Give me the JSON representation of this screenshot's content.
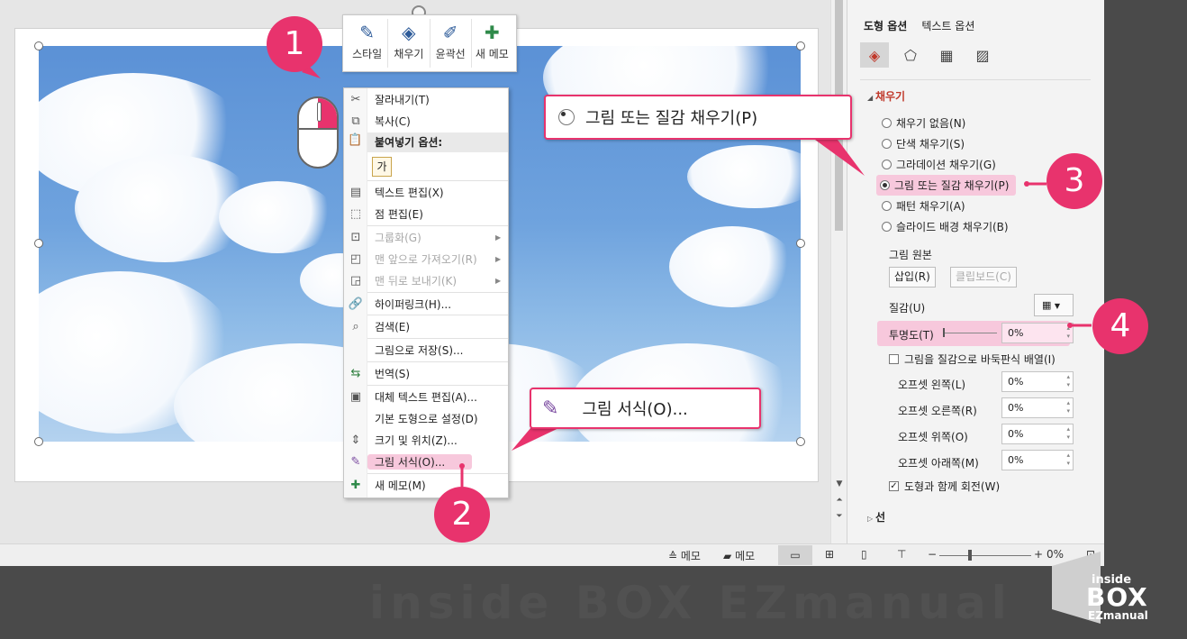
{
  "mini_toolbar": {
    "items": [
      {
        "label": "스타일",
        "icon": "style-brush-icon"
      },
      {
        "label": "채우기",
        "icon": "fill-bucket-icon"
      },
      {
        "label": "윤곽선",
        "icon": "outline-pen-icon"
      },
      {
        "label": "새 메모",
        "icon": "new-comment-icon"
      }
    ]
  },
  "context_menu": {
    "cut": "잘라내기(T)",
    "copy": "복사(C)",
    "paste_options": "붙여넣기 옵션:",
    "paste_glyph": "가",
    "edit_text": "텍스트 편집(X)",
    "edit_points": "점 편집(E)",
    "group": "그룹화(G)",
    "bring_front": "맨 앞으로 가져오기(R)",
    "send_back": "맨 뒤로 보내기(K)",
    "hyperlink": "하이퍼링크(H)...",
    "search": "검색(E)",
    "save_as_picture": "그림으로 저장(S)...",
    "translate": "번역(S)",
    "alt_text": "대체 텍스트 편집(A)...",
    "set_default": "기본 도형으로 설정(D)",
    "size_position": "크기 및 위치(Z)...",
    "format_picture": "그림 서식(O)...",
    "new_comment": "새 메모(M)"
  },
  "callouts": {
    "n1": "1",
    "n2": "2",
    "n3": "3",
    "n4": "4",
    "box_picture_fill": "그림 또는 질감 채우기(P)",
    "box_format_picture": "그림 서식(O)...",
    "accent": "#e8336d"
  },
  "format_pane": {
    "tab_shape": "도형 옵션",
    "tab_text": "텍스트 옵션",
    "fill_section": "채우기",
    "fill_options": [
      "채우기 없음(N)",
      "단색 채우기(S)",
      "그라데이션 채우기(G)",
      "그림 또는 질감 채우기(P)",
      "패턴 채우기(A)",
      "슬라이드 배경 채우기(B)"
    ],
    "selected_fill_index": 3,
    "picture_source": "그림 원본",
    "insert_btn": "삽입(R)",
    "clipboard_btn": "클립보드(C)",
    "texture": "질감(U)",
    "transparency": "투명도(T)",
    "transparency_value": "0%",
    "tile_checkbox": "그림을 질감으로 바둑판식 배열(I)",
    "offset_left": "오프셋 왼쪽(L)",
    "offset_right": "오프셋 오른쪽(R)",
    "offset_top": "오프셋 위쪽(O)",
    "offset_bottom": "오프셋 아래쪽(M)",
    "offset_left_value": "0%",
    "offset_right_value": "0%",
    "offset_top_value": "0%",
    "offset_bottom_value": "0%",
    "rotate_checkbox": "도형과 함께 회전(W)",
    "rotate_checked": true,
    "line_section": "선"
  },
  "status_bar": {
    "notes": "메모",
    "comments": "메모",
    "zoom_minus": "−",
    "zoom_plus": "+",
    "zoom_value": "0%"
  },
  "watermark": "inside BOX EZmanual",
  "logo": {
    "line1": "inside",
    "line2": "BOX",
    "line3": "EZmanual"
  }
}
